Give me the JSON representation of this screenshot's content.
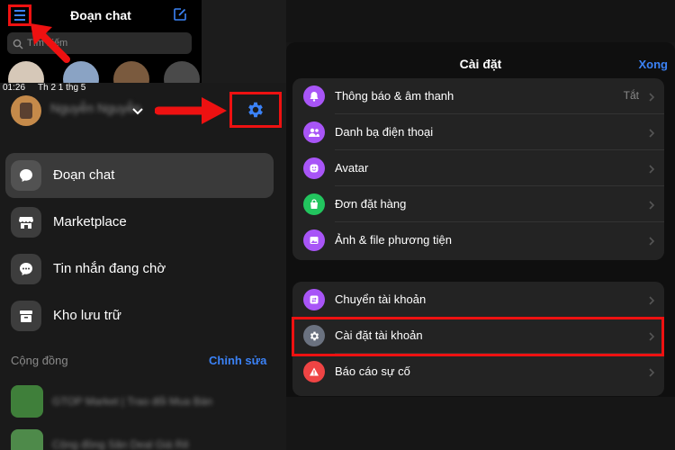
{
  "header": {
    "title": "Đoạn chat",
    "search_placeholder": "Tìm kiếm"
  },
  "status_bar": {
    "time": "01:26",
    "date": "Th 2 1 thg 5"
  },
  "profile": {
    "name": "Nguyễn Nguyễn"
  },
  "nav": {
    "items": [
      {
        "label": "Đoạn chat",
        "icon": "chat-bubble-icon"
      },
      {
        "label": "Marketplace",
        "icon": "store-icon"
      },
      {
        "label": "Tin nhắn đang chờ",
        "icon": "pending-messages-icon"
      },
      {
        "label": "Kho lưu trữ",
        "icon": "archive-icon"
      }
    ]
  },
  "community": {
    "label": "Cộng đồng",
    "edit_label": "Chỉnh sửa",
    "items": [
      {
        "name": "GTOP Market | Trao đổi Mua Bán"
      },
      {
        "name": "Cộng đồng Săn Deal Giá Rẻ"
      }
    ]
  },
  "settings": {
    "title": "Cài đặt",
    "done_label": "Xong",
    "groups": [
      [
        {
          "label": "Thông báo & âm thanh",
          "value": "Tắt",
          "icon": "bell-icon",
          "color": "#a855f7"
        },
        {
          "label": "Danh bạ điện thoại",
          "value": "",
          "icon": "contacts-icon",
          "color": "#a855f7"
        },
        {
          "label": "Avatar",
          "value": "",
          "icon": "avatar-icon",
          "color": "#a855f7"
        },
        {
          "label": "Đơn đặt hàng",
          "value": "",
          "icon": "shopping-bag-icon",
          "color": "#22c55e"
        },
        {
          "label": "Ảnh & file phương tiện",
          "value": "",
          "icon": "photo-icon",
          "color": "#a855f7"
        }
      ],
      [
        {
          "label": "Chuyển tài khoản",
          "value": "",
          "icon": "switch-account-icon",
          "color": "#a855f7"
        },
        {
          "label": "Cài đặt tài khoản",
          "value": "",
          "icon": "gear-icon",
          "color": "#6b7280"
        },
        {
          "label": "Báo cáo sự cố",
          "value": "",
          "icon": "warning-icon",
          "color": "#ef4444"
        }
      ]
    ]
  },
  "colors": {
    "accent": "#3b82f6",
    "highlight": "#ee1111",
    "background": "#1a1a1a"
  }
}
